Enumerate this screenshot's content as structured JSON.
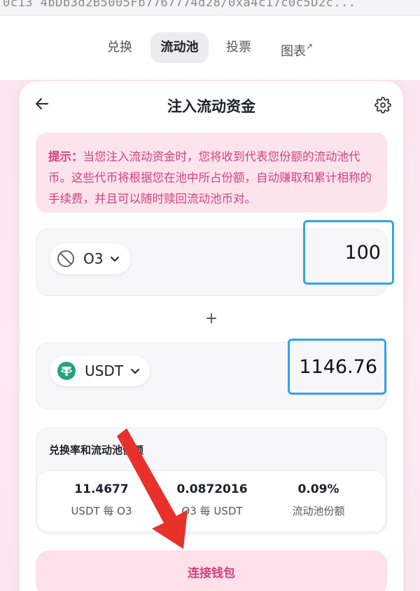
{
  "urlbar": {
    "text": "0c13 4bDb3d2B5005Fb7767774d28/0xa4c17c0c5D2c..."
  },
  "nav": {
    "items": [
      {
        "label": "兑换",
        "active": false
      },
      {
        "label": "流动池",
        "active": true
      },
      {
        "label": "投票",
        "active": false
      },
      {
        "label": "图表",
        "active": false,
        "suffix": "↗"
      }
    ]
  },
  "card": {
    "title": "注入流动资金",
    "back_icon": "arrow-left-icon",
    "settings_icon": "gear-icon"
  },
  "notice": {
    "prefix": "提示：",
    "text": "当您注入流动资金时，您将收到代表您份额的流动池代币。这些代币将根据您在池中所占份额，自动赚取和累计相称的手续费，并且可以随时赎回流动池币对。"
  },
  "token_a": {
    "symbol": "O3",
    "icon": "blocked-circle-icon",
    "amount": "100"
  },
  "plus": "+",
  "token_b": {
    "symbol": "USDT",
    "icon": "tether-icon",
    "amount": "1146.76",
    "icon_color": "#26a17b"
  },
  "rates": {
    "title": "兑换率和流动池份额",
    "items": [
      {
        "value": "11.4677",
        "label": "USDT 每 O3"
      },
      {
        "value": "0.0872016",
        "label": "O3 每 USDT"
      },
      {
        "value": "0.09%",
        "label": "流动池份额"
      }
    ]
  },
  "connect_button": "连接钱包",
  "colors": {
    "accent": "#d4407e",
    "input_border": "#2ea6e6",
    "arrow": "#e8312a"
  }
}
